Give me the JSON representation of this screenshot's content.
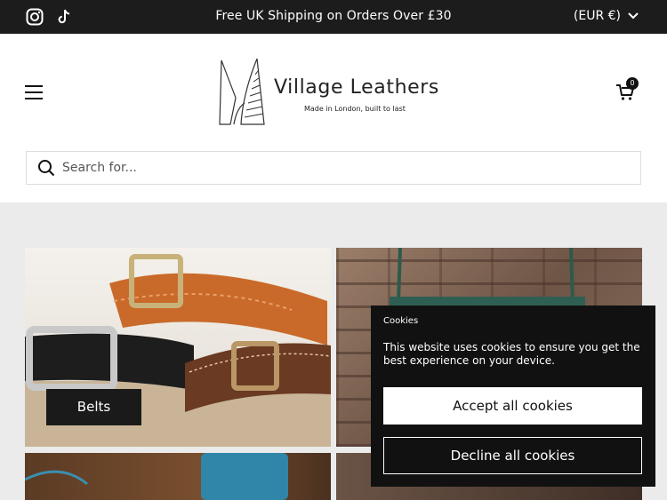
{
  "announcement": {
    "text": "Free UK Shipping on Orders Over £30",
    "currency": "(EUR €)",
    "social_icons": [
      "instagram-icon",
      "tiktok-icon"
    ]
  },
  "header": {
    "brand": "Village Leathers",
    "tagline": "Made in London, built to last",
    "cart_count": "0"
  },
  "search": {
    "placeholder": "Search for..."
  },
  "collections": [
    {
      "label": "Belts"
    },
    {
      "label": ""
    }
  ],
  "cookie_banner": {
    "title": "Cookies",
    "text": "This website uses cookies to ensure you get the best experience on your device.",
    "accept_label": "Accept all cookies",
    "decline_label": "Decline all cookies"
  },
  "colors": {
    "bar": "#1c1c1c",
    "accent": "#111111",
    "page_bg": "#ebebeb"
  }
}
